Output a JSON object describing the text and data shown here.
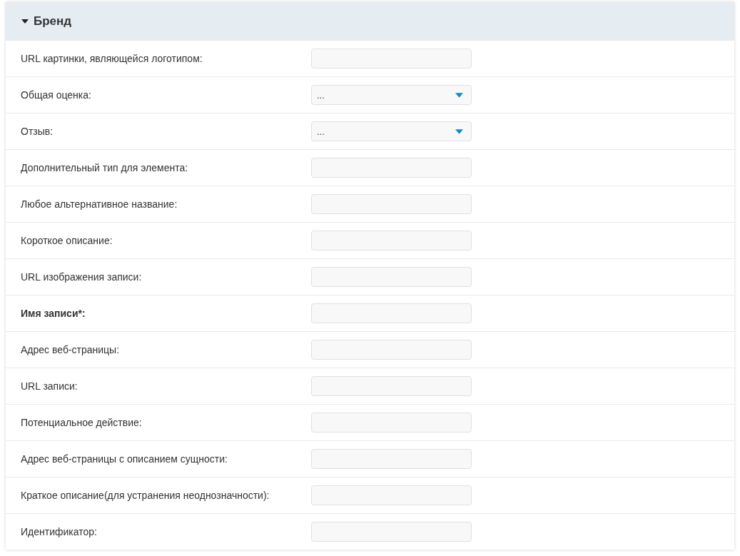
{
  "panel": {
    "title": "Бренд",
    "expanded": true
  },
  "fields": [
    {
      "label": "URL картинки, являющейся логотипом:",
      "kind": "text",
      "required": false
    },
    {
      "label": "Общая оценка:",
      "kind": "select",
      "value": "...",
      "required": false
    },
    {
      "label": "Отзыв:",
      "kind": "select",
      "value": "...",
      "required": false
    },
    {
      "label": "Дополнительный тип для элемента:",
      "kind": "text",
      "required": false
    },
    {
      "label": "Любое альтернативное название:",
      "kind": "text",
      "required": false
    },
    {
      "label": "Короткое описание:",
      "kind": "text",
      "required": false
    },
    {
      "label": "URL изображения записи:",
      "kind": "text",
      "required": false
    },
    {
      "label": "Имя записи*:",
      "kind": "text",
      "required": true
    },
    {
      "label": "Адрес веб-страницы:",
      "kind": "text",
      "required": false
    },
    {
      "label": "URL записи:",
      "kind": "text",
      "required": false
    },
    {
      "label": "Потенциальное действие:",
      "kind": "text",
      "required": false
    },
    {
      "label": "Адрес веб-страницы с описанием сущности:",
      "kind": "text",
      "required": false
    },
    {
      "label": "Краткое описание(для устранения неоднозначности):",
      "kind": "text",
      "required": false
    },
    {
      "label": "Идентификатор:",
      "kind": "text",
      "required": false
    }
  ]
}
